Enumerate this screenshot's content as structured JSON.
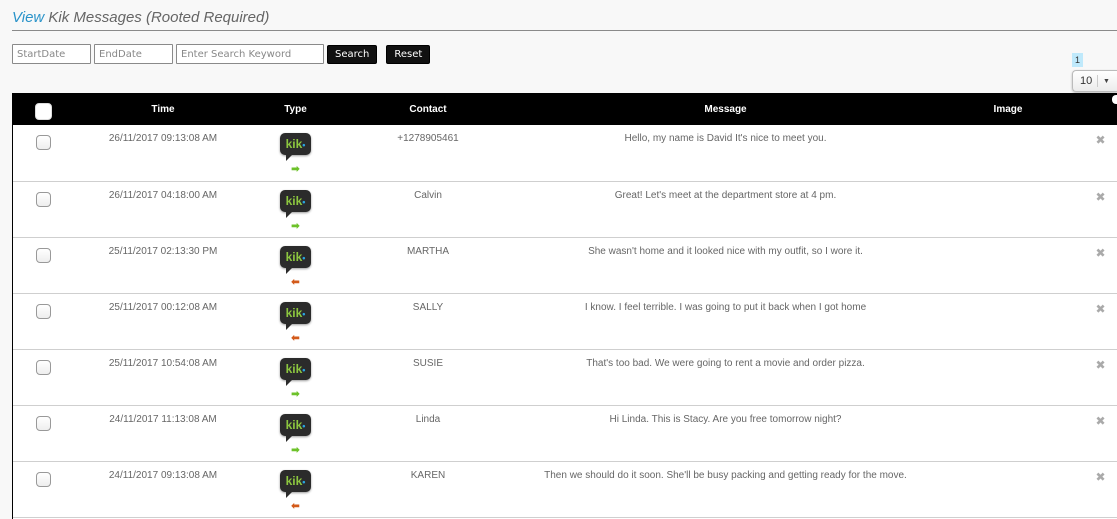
{
  "page": {
    "title_accent": "View",
    "title_rest": " Kik Messages (Rooted Required)"
  },
  "filters": {
    "start_placeholder": "StartDate",
    "end_placeholder": "EndDate",
    "keyword_placeholder": "Enter Search Keyword",
    "search_label": "Search",
    "reset_label": "Reset"
  },
  "pagination": {
    "current_page": "1",
    "page_size": "10"
  },
  "table": {
    "columns": [
      "",
      "Time",
      "Type",
      "Contact",
      "Message",
      "Image",
      ""
    ],
    "rows": [
      {
        "time": "26/11/2017 09:13:08 AM",
        "type": "kik",
        "direction": "outgoing",
        "contact": "+1278905461",
        "message": "Hello, my name is David It's nice to meet you."
      },
      {
        "time": "26/11/2017 04:18:00 AM",
        "type": "kik",
        "direction": "outgoing",
        "contact": "Calvin",
        "message": "Great! Let's meet at the department store at 4 pm."
      },
      {
        "time": "25/11/2017 02:13:30 PM",
        "type": "kik",
        "direction": "incoming",
        "contact": "MARTHA",
        "message": "She wasn't home and it looked nice with my outfit, so I wore it."
      },
      {
        "time": "25/11/2017 00:12:08 AM",
        "type": "kik",
        "direction": "incoming",
        "contact": "SALLY",
        "message": "I know. I feel terrible. I was going to put it back when I got home"
      },
      {
        "time": "25/11/2017 10:54:08 AM",
        "type": "kik",
        "direction": "outgoing",
        "contact": "SUSIE",
        "message": "That's too bad. We were going to rent a movie and order pizza."
      },
      {
        "time": "24/11/2017 11:13:08 AM",
        "type": "kik",
        "direction": "outgoing",
        "contact": "Linda",
        "message": "Hi Linda. This is Stacy. Are you free tomorrow night?"
      },
      {
        "time": "24/11/2017 09:13:08 AM",
        "type": "kik",
        "direction": "incoming",
        "contact": "KAREN",
        "message": "Then we should do it soon. She'll be busy packing and getting ready for the move."
      }
    ]
  },
  "icons": {
    "kik_logo_text": "kik",
    "kik_logo_dot": "•",
    "outgoing_arrow": "➡",
    "incoming_arrow": "⬅",
    "delete": "✖",
    "page_size_caret": "▼"
  },
  "colors": {
    "accent": "#2a93c9",
    "header_bg": "#000000",
    "outgoing": "#6dc22a",
    "incoming": "#d35a1a",
    "kik_green": "#8cc63f",
    "page_highlight": "#bfe9fb"
  }
}
